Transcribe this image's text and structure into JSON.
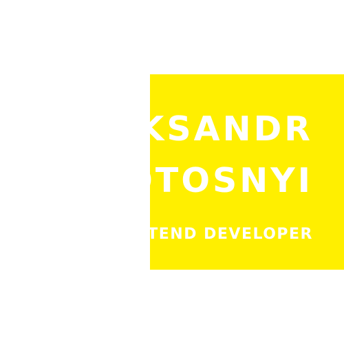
{
  "colors": {
    "background": "#ffffff",
    "accent": "#ffef00",
    "text": "#ffffff"
  },
  "name": {
    "first": "OLEKSANDR",
    "last": "KHOTOSNYI"
  },
  "role": "FRONTEND DEVELOPER"
}
